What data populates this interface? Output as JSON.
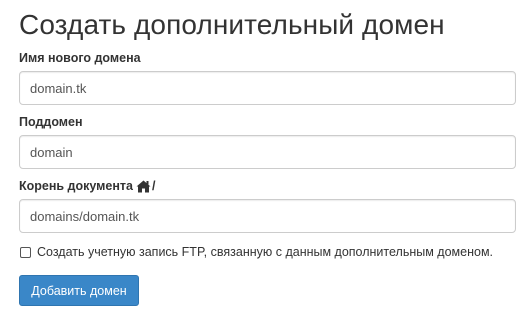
{
  "page": {
    "title": "Создать дополнительный домен"
  },
  "form": {
    "new_domain": {
      "label": "Имя нового домена",
      "value": "domain.tk"
    },
    "subdomain": {
      "label": "Поддомен",
      "value": "domain"
    },
    "document_root": {
      "label": "Корень документа",
      "label_suffix": "/",
      "icon": "home-icon",
      "value": "domains/domain.tk"
    },
    "ftp_checkbox": {
      "label": "Создать учетную запись FTP, связанную с данным дополнительным доменом.",
      "checked": false
    },
    "submit_label": "Добавить домен"
  },
  "colors": {
    "button_bg": "#3a87c8",
    "text": "#333333",
    "input_border": "#cccccc"
  }
}
